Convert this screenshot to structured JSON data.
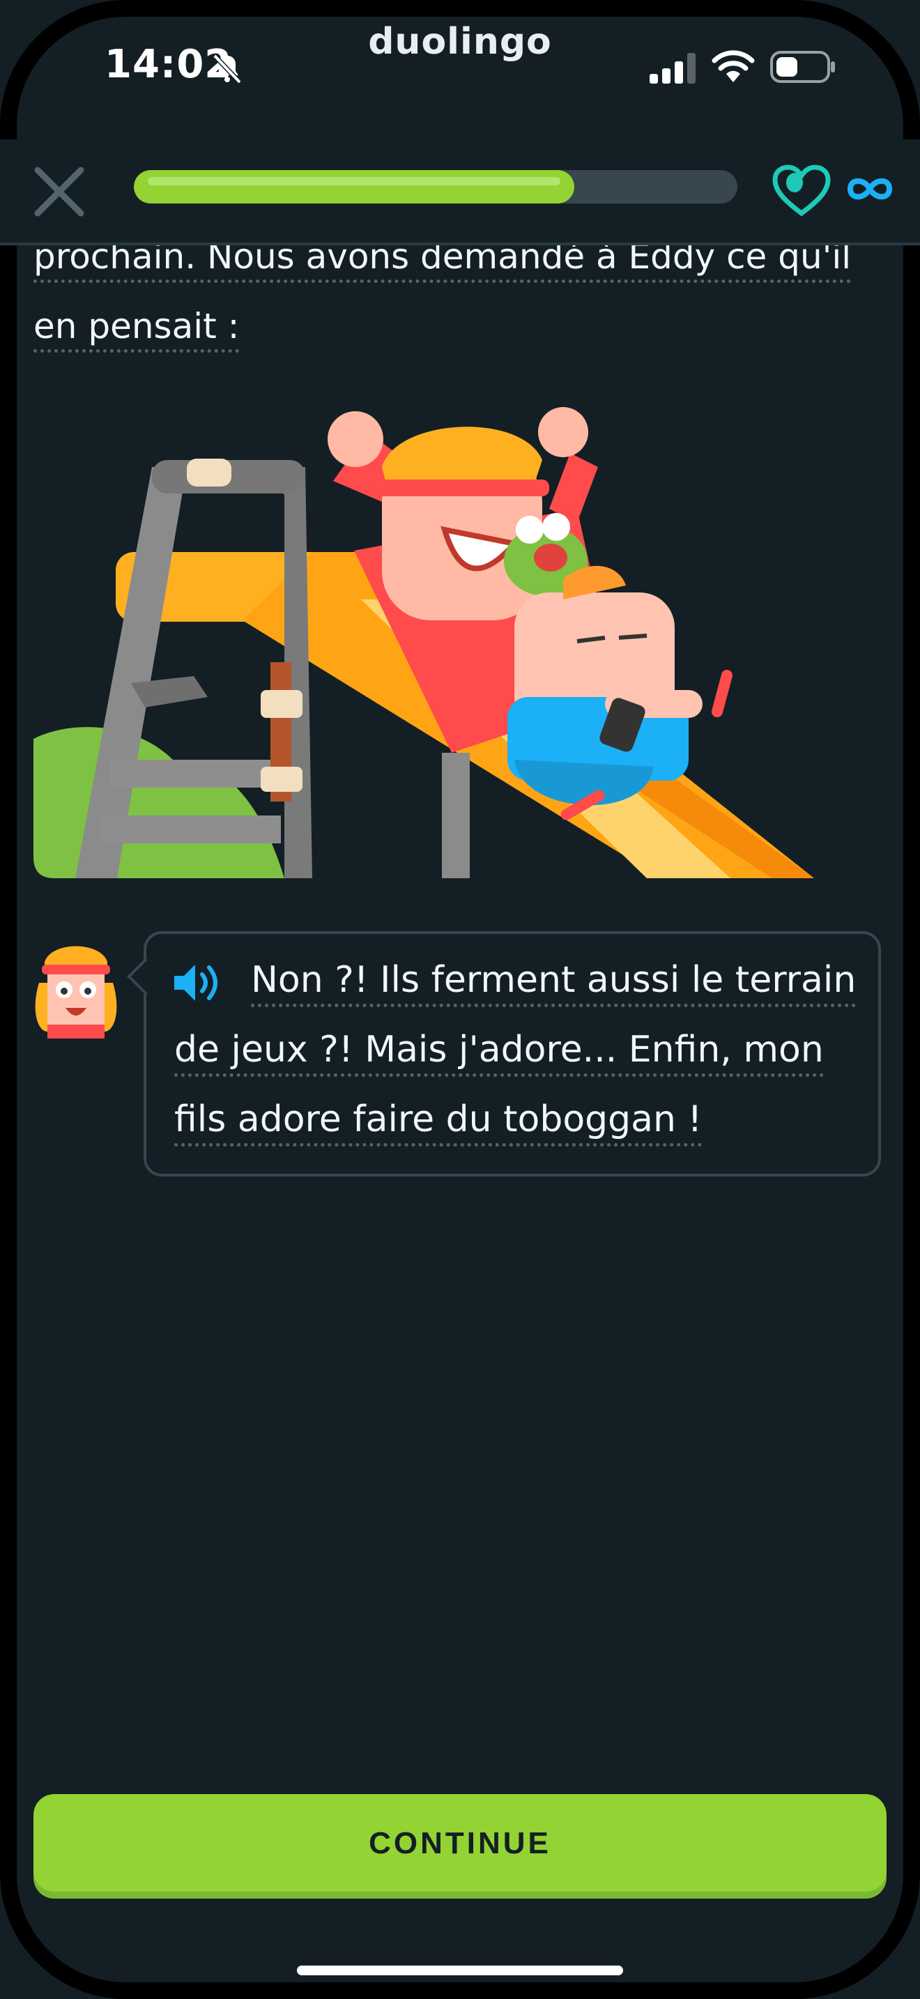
{
  "status_bar": {
    "time": "14:02",
    "brand": "duolingo",
    "icons": [
      "bell-muted-icon",
      "cellular-signal-icon",
      "wifi-icon",
      "battery-icon"
    ]
  },
  "lesson_header": {
    "progress": 0.73,
    "hearts": "∞",
    "icons": [
      "close-icon",
      "heart-icon",
      "infinity-icon"
    ],
    "colors": {
      "progress": "#93d333",
      "track": "#37464f",
      "heart": "#1ec9b7",
      "infinity": "#1cb0f6"
    }
  },
  "story": {
    "text_lines": [
      "prochain. Nous avons demandé à Eddy ce qu'il",
      "en pensait :"
    ]
  },
  "dialogue": {
    "lines": [
      "Non ?! Ils ferment aussi le terrain",
      "de jeux ?! Mais j'adore... Enfin, mon",
      "fils adore faire du toboggan !"
    ],
    "audio_icon": "speaker-icon"
  },
  "footer": {
    "continue_label": "CONTINUE",
    "button_color": "#93d333"
  }
}
